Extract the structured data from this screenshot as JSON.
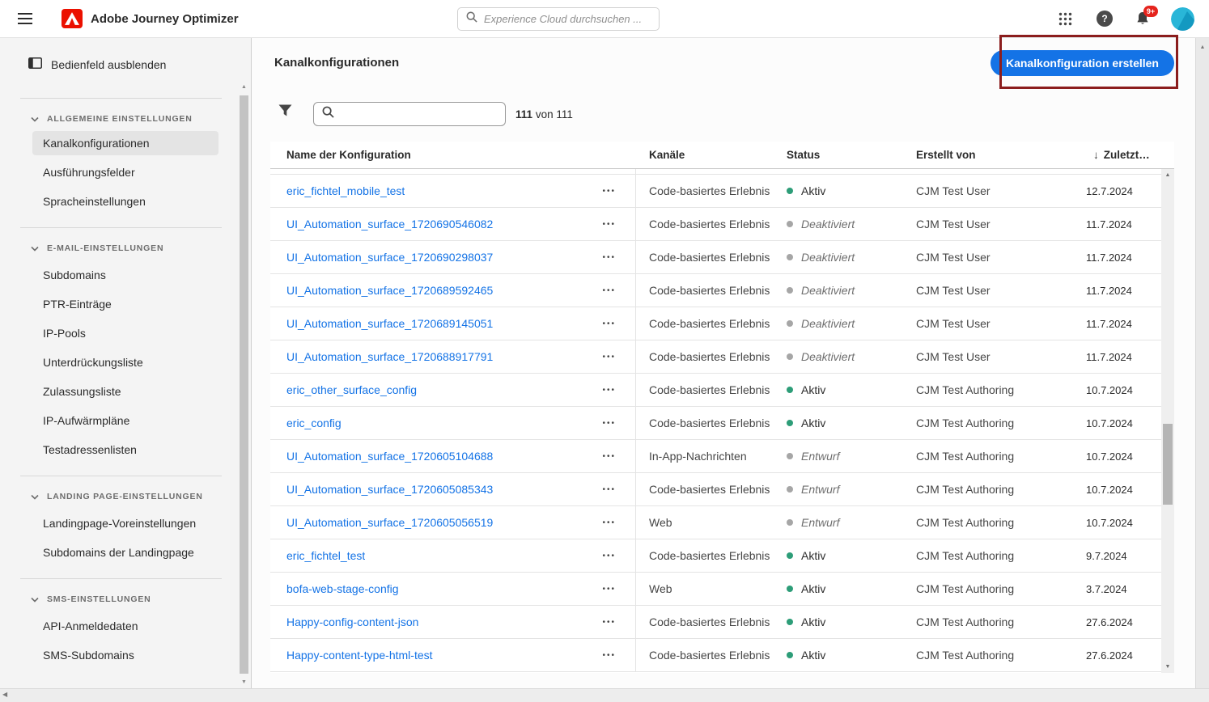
{
  "topbar": {
    "app_title": "Adobe Journey Optimizer",
    "search_placeholder": "Experience Cloud durchsuchen ...",
    "notification_badge": "9+"
  },
  "sidebar": {
    "hide_panel_label": "Bedienfeld ausblenden",
    "sections": [
      {
        "title": "ALLGEMEINE EINSTELLUNGEN",
        "items": [
          {
            "label": "Kanalkonfigurationen",
            "selected": true
          },
          {
            "label": "Ausführungsfelder"
          },
          {
            "label": "Spracheinstellungen"
          }
        ]
      },
      {
        "title": "E-MAIL-EINSTELLUNGEN",
        "items": [
          {
            "label": "Subdomains"
          },
          {
            "label": "PTR-Einträge"
          },
          {
            "label": "IP-Pools"
          },
          {
            "label": "Unterdrückungsliste"
          },
          {
            "label": "Zulassungsliste"
          },
          {
            "label": "IP-Aufwärmpläne"
          },
          {
            "label": "Testadressenlisten"
          }
        ]
      },
      {
        "title": "LANDING PAGE-EINSTELLUNGEN",
        "items": [
          {
            "label": "Landingpage-Voreinstellungen"
          },
          {
            "label": "Subdomains der Landingpage"
          }
        ]
      },
      {
        "title": "SMS-EINSTELLUNGEN",
        "items": [
          {
            "label": "API-Anmeldedaten"
          },
          {
            "label": "SMS-Subdomains"
          }
        ]
      }
    ]
  },
  "main": {
    "page_title": "Kanalkonfigurationen",
    "create_button_label": "Kanalkonfiguration erstellen",
    "results_count": "111",
    "results_of": "von",
    "results_total": "111"
  },
  "table": {
    "columns": {
      "name": "Name der Konfiguration",
      "channels": "Kanäle",
      "status": "Status",
      "created_by": "Erstellt von",
      "last_modified": "Zuletzt…"
    },
    "rows": [
      {
        "name": "eric_fichtel_mobile_test",
        "channels": "Code-basiertes Erlebnis",
        "status": "Aktiv",
        "status_type": "active",
        "created_by": "CJM Test User",
        "modified": "12.7.2024"
      },
      {
        "name": "UI_Automation_surface_1720690546082",
        "channels": "Code-basiertes Erlebnis",
        "status": "Deaktiviert",
        "status_type": "disabled",
        "created_by": "CJM Test User",
        "modified": "11.7.2024"
      },
      {
        "name": "UI_Automation_surface_1720690298037",
        "channels": "Code-basiertes Erlebnis",
        "status": "Deaktiviert",
        "status_type": "disabled",
        "created_by": "CJM Test User",
        "modified": "11.7.2024"
      },
      {
        "name": "UI_Automation_surface_1720689592465",
        "channels": "Code-basiertes Erlebnis",
        "status": "Deaktiviert",
        "status_type": "disabled",
        "created_by": "CJM Test User",
        "modified": "11.7.2024"
      },
      {
        "name": "UI_Automation_surface_1720689145051",
        "channels": "Code-basiertes Erlebnis",
        "status": "Deaktiviert",
        "status_type": "disabled",
        "created_by": "CJM Test User",
        "modified": "11.7.2024"
      },
      {
        "name": "UI_Automation_surface_1720688917791",
        "channels": "Code-basiertes Erlebnis",
        "status": "Deaktiviert",
        "status_type": "disabled",
        "created_by": "CJM Test User",
        "modified": "11.7.2024"
      },
      {
        "name": "eric_other_surface_config",
        "channels": "Code-basiertes Erlebnis",
        "status": "Aktiv",
        "status_type": "active",
        "created_by": "CJM Test Authoring",
        "modified": "10.7.2024"
      },
      {
        "name": "eric_config",
        "channels": "Code-basiertes Erlebnis",
        "status": "Aktiv",
        "status_type": "active",
        "created_by": "CJM Test Authoring",
        "modified": "10.7.2024"
      },
      {
        "name": "UI_Automation_surface_1720605104688",
        "channels": "In-App-Nachrichten",
        "status": "Entwurf",
        "status_type": "draft",
        "created_by": "CJM Test Authoring",
        "modified": "10.7.2024"
      },
      {
        "name": "UI_Automation_surface_1720605085343",
        "channels": "Code-basiertes Erlebnis",
        "status": "Entwurf",
        "status_type": "draft",
        "created_by": "CJM Test Authoring",
        "modified": "10.7.2024"
      },
      {
        "name": "UI_Automation_surface_1720605056519",
        "channels": "Web",
        "status": "Entwurf",
        "status_type": "draft",
        "created_by": "CJM Test Authoring",
        "modified": "10.7.2024"
      },
      {
        "name": "eric_fichtel_test",
        "channels": "Code-basiertes Erlebnis",
        "status": "Aktiv",
        "status_type": "active",
        "created_by": "CJM Test Authoring",
        "modified": "9.7.2024"
      },
      {
        "name": "bofa-web-stage-config",
        "channels": "Web",
        "status": "Aktiv",
        "status_type": "active",
        "created_by": "CJM Test Authoring",
        "modified": "3.7.2024"
      },
      {
        "name": "Happy-config-content-json",
        "channels": "Code-basiertes Erlebnis",
        "status": "Aktiv",
        "status_type": "active",
        "created_by": "CJM Test Authoring",
        "modified": "27.6.2024"
      },
      {
        "name": "Happy-content-type-html-test",
        "channels": "Code-basiertes Erlebnis",
        "status": "Aktiv",
        "status_type": "active",
        "created_by": "CJM Test Authoring",
        "modified": "27.6.2024"
      }
    ]
  },
  "icons": {
    "more_actions": "•••",
    "sort_desc": "↓"
  },
  "colors": {
    "accent_blue": "#1473E6",
    "link_blue": "#1473E6",
    "status_active_green": "#2D9D78",
    "status_inactive_gray": "#a6a6a6",
    "annotation_red": "#8b1d1d",
    "badge_red": "#e5241d",
    "adobe_logo_red": "#EB1000"
  }
}
